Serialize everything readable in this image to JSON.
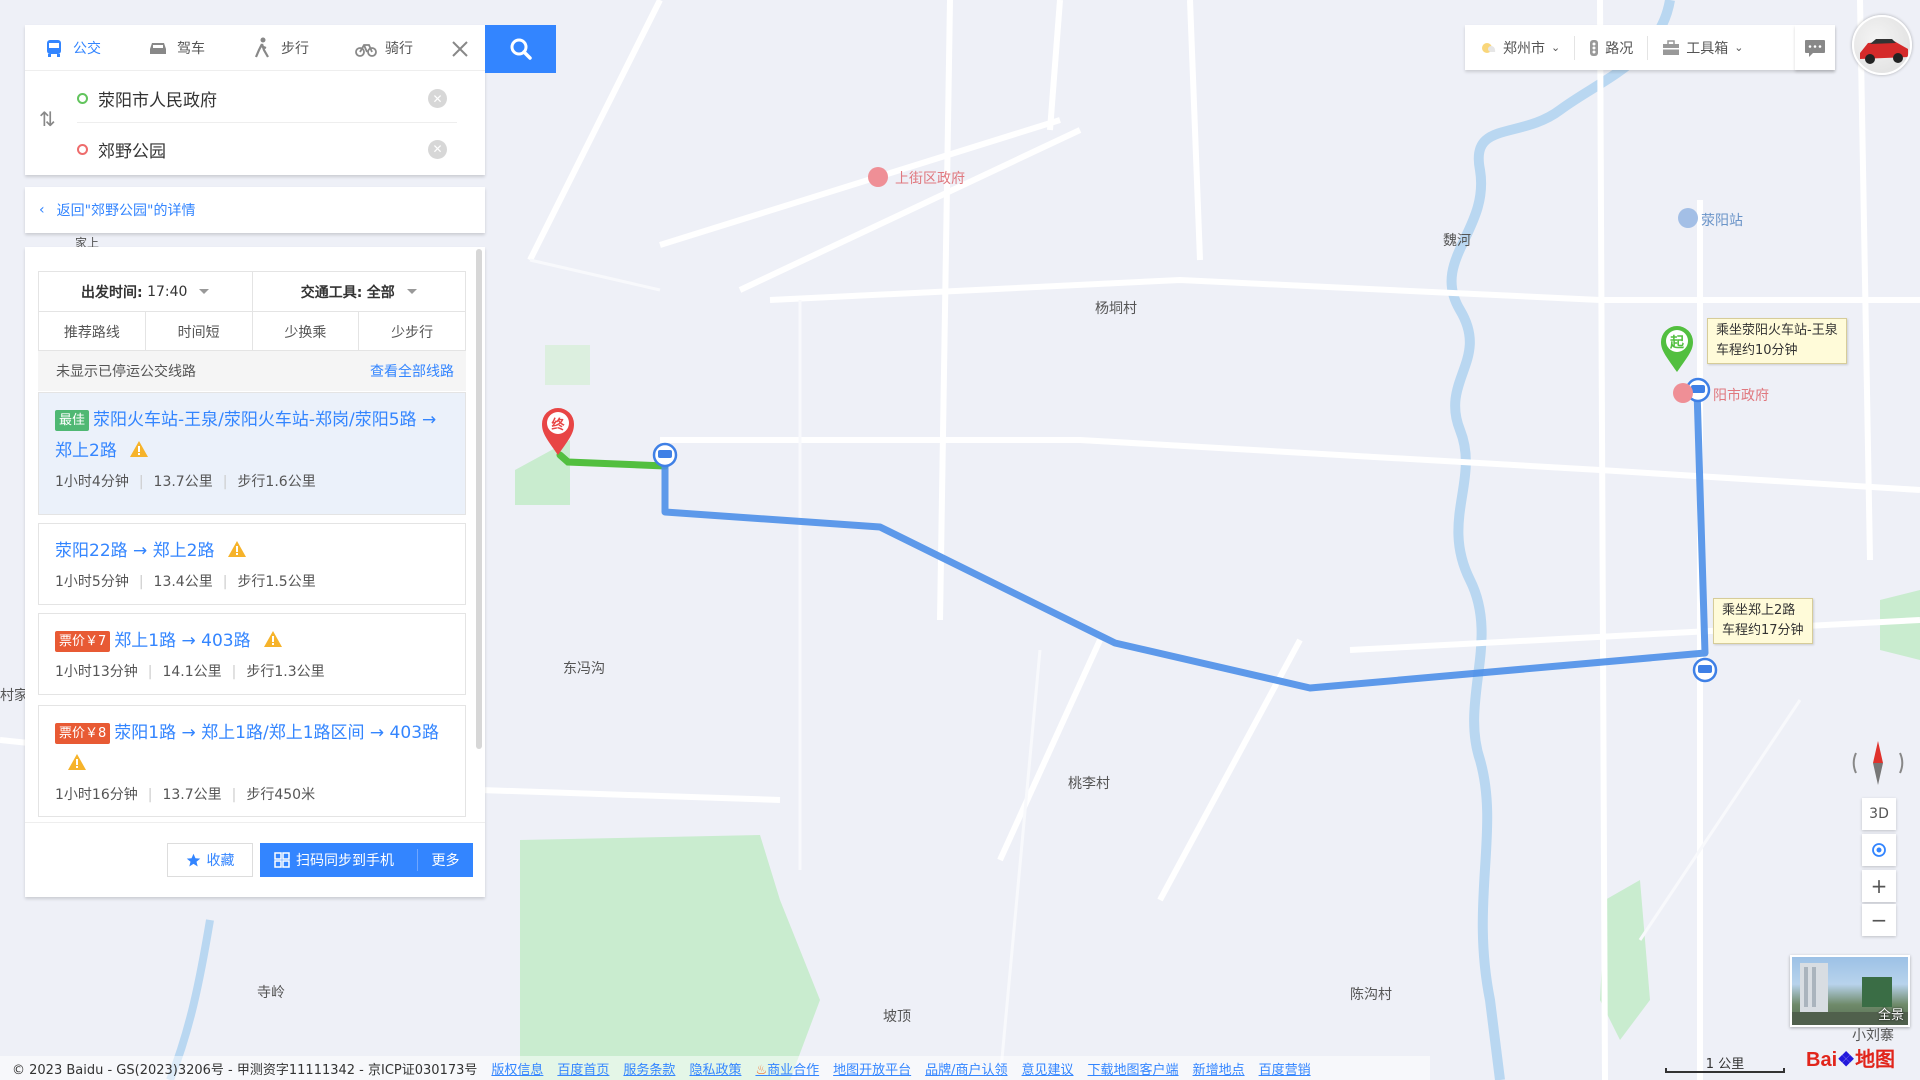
{
  "search": {
    "modes": [
      {
        "label": "公交",
        "icon": "bus-icon",
        "active": true
      },
      {
        "label": "驾车",
        "icon": "car-icon",
        "active": false
      },
      {
        "label": "步行",
        "icon": "walk-icon",
        "active": false
      },
      {
        "label": "骑行",
        "icon": "bike-icon",
        "active": false
      }
    ],
    "start": "荥阳市人民政府",
    "end": "郊野公园"
  },
  "back_link": "返回\"郊野公园\"的详情",
  "filters": {
    "depart_label": "出发时间:",
    "depart_value": "17:40",
    "vehicle_label": "交通工具:",
    "vehicle_value": "全部",
    "sort_tabs": [
      "推荐路线",
      "时间短",
      "少换乘",
      "少步行"
    ]
  },
  "notice": {
    "text": "未显示已停运公交线路",
    "link": "查看全部线路"
  },
  "routes": [
    {
      "tag": "最佳",
      "tag_color": "#4fb873",
      "title": "荥阳火车站-王泉/荥阳火车站-郑岗/荥阳5路 → 郑上2路",
      "duration": "1小时4分钟",
      "distance": "13.7公里",
      "walk": "步行1.6公里"
    },
    {
      "tag": "",
      "tag_color": "",
      "title": "荥阳22路 → 郑上2路",
      "duration": "1小时5分钟",
      "distance": "13.4公里",
      "walk": "步行1.5公里"
    },
    {
      "tag": "票价￥7",
      "tag_color": "#e85a34",
      "title": "郑上1路 → 403路",
      "duration": "1小时13分钟",
      "distance": "14.1公里",
      "walk": "步行1.3公里"
    },
    {
      "tag": "票价￥8",
      "tag_color": "#e85a34",
      "title": "荥阳1路 → 郑上1路/郑上1路区间 → 403路",
      "duration": "1小时16分钟",
      "distance": "13.7公里",
      "walk": "步行450米"
    }
  ],
  "footer_buttons": {
    "favorite": "收藏",
    "sync": "扫码同步到手机",
    "more": "更多"
  },
  "toolbar": {
    "city": "郑州市",
    "traffic": "路况",
    "tools": "工具箱"
  },
  "map_labels": {
    "gov": "上街区政府",
    "station": "荥阳站",
    "weihe": "魏河",
    "yangtong": "杨垌村",
    "dongfeng": "东冯沟",
    "taoli": "桃李村",
    "siling": "寺岭",
    "poding": "坡顶",
    "chengou": "陈沟村",
    "xiaoliu": "小刘寨",
    "yang_gov": "阳市政府",
    "start_marker": "起",
    "end_marker": "终",
    "left_cut1": "家上",
    "left_cut2": "村家"
  },
  "tips": {
    "tip1_line1": "乘坐荥阳火车站-王泉",
    "tip1_line2": "车程约10分钟",
    "tip2_line1": "乘坐郑上2路",
    "tip2_line2": "车程约17分钟"
  },
  "controls": {
    "three_d": "3D",
    "zoom_in": "+",
    "zoom_out": "−",
    "pano": "全景"
  },
  "scale": "1 公里",
  "copyright": "© 2023 Baidu - GS(2023)3206号 - 甲测资字11111342 - 京ICP证030173号",
  "footer_links": [
    "版权信息",
    "百度首页",
    "服务条款",
    "隐私政策",
    "商业合作",
    "地图开放平台",
    "品牌/商户认领",
    "意见建议",
    "下载地图客户端",
    "新增地点",
    "百度营销"
  ],
  "logo": {
    "a": "Bai",
    "b": "地图"
  }
}
